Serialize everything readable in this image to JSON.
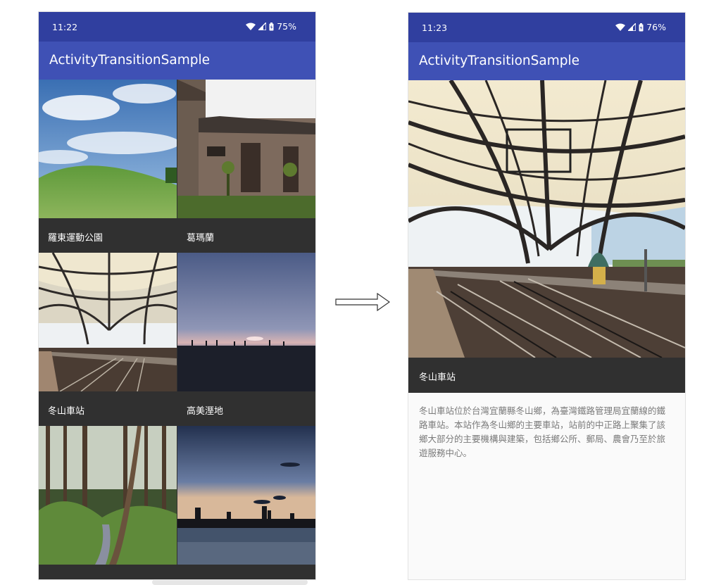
{
  "left_screen": {
    "status_bar": {
      "time": "11:22",
      "battery": "75%"
    },
    "app_bar": {
      "title": "ActivityTransitionSample"
    },
    "grid_items": [
      {
        "caption": "羅東運動公園"
      },
      {
        "caption": "葛瑪蘭"
      },
      {
        "caption": "冬山車站"
      },
      {
        "caption": "高美溼地"
      },
      {
        "caption": ""
      },
      {
        "caption": ""
      }
    ]
  },
  "right_screen": {
    "status_bar": {
      "time": "11:23",
      "battery": "76%"
    },
    "app_bar": {
      "title": "ActivityTransitionSample"
    },
    "detail": {
      "caption": "冬山車站",
      "description": "冬山車站位於台灣宜蘭縣冬山鄉，為臺灣鐵路管理局宜蘭線的鐵路車站。本站作為冬山鄉的主要車站，站前的中正路上聚集了該鄉大部分的主要機構與建築，包括鄉公所、郵局、農會乃至於旅遊服務中心。"
    }
  },
  "icons": {
    "status": [
      "wifi-icon",
      "cell-signal-icon",
      "battery-charging-icon"
    ],
    "transition": "right-arrow-icon"
  },
  "colors": {
    "status_bar": "#303f9f",
    "app_bar": "#3f51b5",
    "caption_bar": "#303030",
    "detail_background": "#fafafa"
  }
}
